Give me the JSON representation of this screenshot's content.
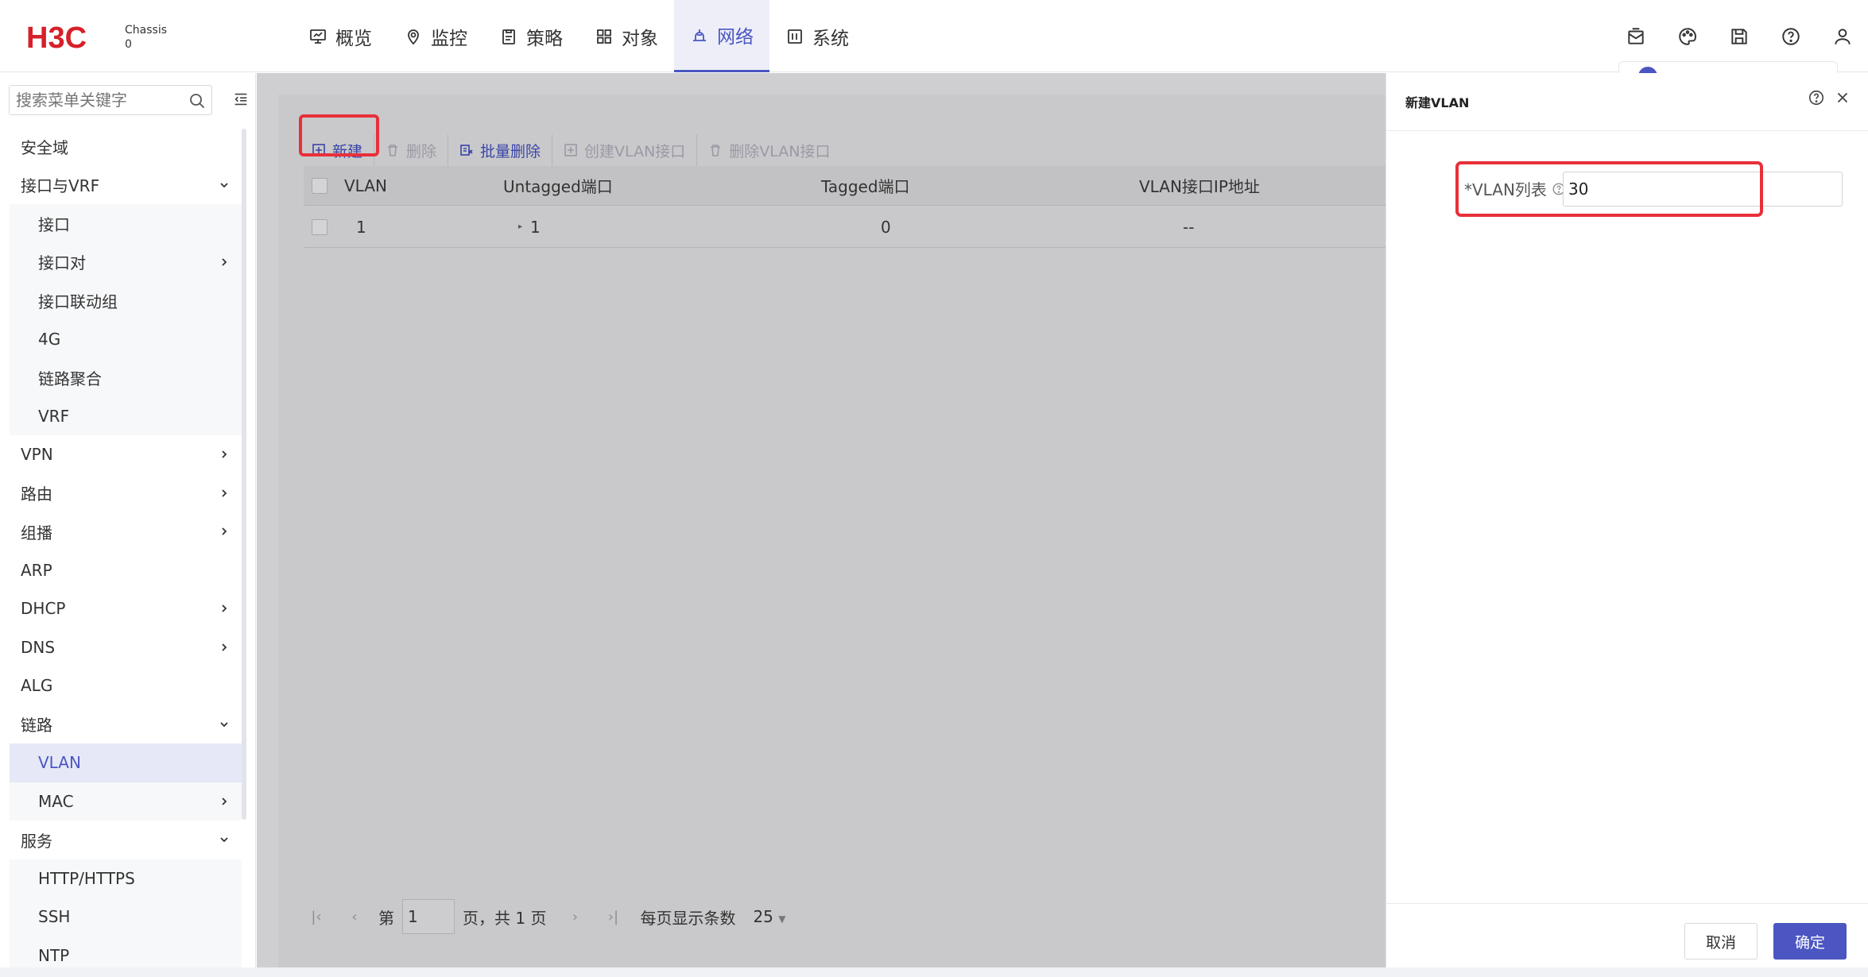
{
  "header": {
    "logo": "H3C",
    "device_label": "Chassis",
    "device_index": "0",
    "nav": [
      {
        "label": "概览",
        "icon": "monitor-icon"
      },
      {
        "label": "监控",
        "icon": "location-icon"
      },
      {
        "label": "策略",
        "icon": "clipboard-icon"
      },
      {
        "label": "对象",
        "icon": "grid-icon"
      },
      {
        "label": "网络",
        "icon": "network-icon",
        "active": true
      },
      {
        "label": "系统",
        "icon": "system-icon"
      }
    ],
    "right_icons": [
      "message-icon",
      "palette-icon",
      "save-icon",
      "help-icon",
      "user-icon"
    ]
  },
  "sidebar": {
    "search_placeholder": "搜索菜单关键字",
    "items": [
      {
        "label": "安全域",
        "level": 0
      },
      {
        "label": "接口与VRF",
        "level": 0,
        "expanded": true
      },
      {
        "label": "接口",
        "level": 1
      },
      {
        "label": "接口对",
        "level": 1,
        "has_children": true
      },
      {
        "label": "接口联动组",
        "level": 1
      },
      {
        "label": "4G",
        "level": 1
      },
      {
        "label": "链路聚合",
        "level": 1
      },
      {
        "label": "VRF",
        "level": 1
      },
      {
        "label": "VPN",
        "level": 0,
        "has_children": true
      },
      {
        "label": "路由",
        "level": 0,
        "has_children": true
      },
      {
        "label": "组播",
        "level": 0,
        "has_children": true
      },
      {
        "label": "ARP",
        "level": 0
      },
      {
        "label": "DHCP",
        "level": 0,
        "has_children": true
      },
      {
        "label": "DNS",
        "level": 0,
        "has_children": true
      },
      {
        "label": "ALG",
        "level": 0
      },
      {
        "label": "链路",
        "level": 0,
        "expanded": true
      },
      {
        "label": "VLAN",
        "level": 1,
        "active": true
      },
      {
        "label": "MAC",
        "level": 1,
        "has_children": true
      },
      {
        "label": "服务",
        "level": 0,
        "expanded": true
      },
      {
        "label": "HTTP/HTTPS",
        "level": 1
      },
      {
        "label": "SSH",
        "level": 1
      },
      {
        "label": "NTP",
        "level": 1
      }
    ]
  },
  "toolbar": {
    "new": "新建",
    "delete": "删除",
    "batch_delete": "批量删除",
    "create_vlan_if": "创建VLAN接口",
    "delete_vlan_if": "删除VLAN接口"
  },
  "table": {
    "columns": [
      "VLAN",
      "Untagged端口",
      "Tagged端口",
      "VLAN接口IP地址"
    ],
    "rows": [
      {
        "vlan": "1",
        "untagged": "1",
        "tagged": "0",
        "ip": "--"
      }
    ]
  },
  "pager": {
    "prefix": "第",
    "page": "1",
    "suffix": "页，共 1 页",
    "per_page_label": "每页显示条数",
    "per_page": "25"
  },
  "drawer": {
    "title": "新建VLAN",
    "field_label": "*VLAN列表",
    "field_value": "30",
    "cancel": "取消",
    "ok": "确定"
  }
}
